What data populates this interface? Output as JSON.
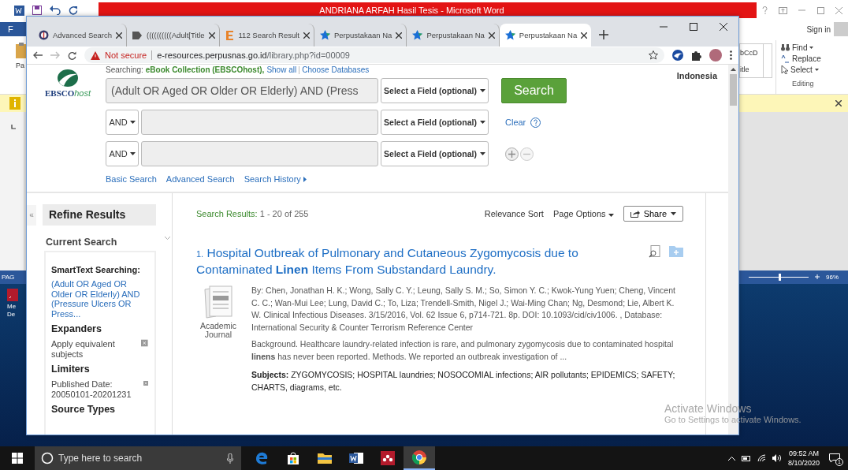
{
  "word": {
    "title": "ANDRIANA ARFAH  Hasil Tesis -  Microsoft Word",
    "file_tab": "F",
    "paste_label": "Pa",
    "sign_in": "Sign in",
    "style_preview": "bCcD",
    "style_name": "itle",
    "editing": [
      {
        "label": "Find",
        "has_menu": true
      },
      {
        "label": "Replace",
        "has_menu": false
      },
      {
        "label": "Select",
        "has_menu": true
      }
    ],
    "editing_group": "Editing",
    "status_text": "PAG",
    "zoom": {
      "level": 0.5,
      "reading": "96%"
    }
  },
  "desktop": {
    "icon_label": "Me De"
  },
  "chrome": {
    "tabs": [
      {
        "title": "Advanced Search",
        "kind": "ebsco",
        "selected": false
      },
      {
        "title": "((((((((((Adult[Title",
        "kind": "flag",
        "selected": false
      },
      {
        "title": "112 Search Result",
        "kind": "letter",
        "selected": false
      },
      {
        "title": "Perpustakaan Na",
        "kind": "star",
        "selected": false
      },
      {
        "title": "Perpustakaan Na",
        "kind": "star",
        "selected": false
      },
      {
        "title": "Perpustakaan Na",
        "kind": "star",
        "selected": true
      }
    ],
    "address": {
      "security": "Not secure",
      "host": "e-resources.perpusnas.go.id",
      "path": "/library.php?id=00009"
    }
  },
  "page": {
    "logo": {
      "text": "EBSCO",
      "suffix": "host"
    },
    "searching": {
      "label": "Searching:",
      "database": "eBook Collection (EBSCOhost),",
      "show_all": "Show all",
      "choose": "Choose Databases"
    },
    "library": "Indonesia",
    "search_rows": [
      {
        "value": "(Adult OR Aged OR Older OR Elderly) AND (Press",
        "field": "Select a Field (optional)"
      },
      {
        "operator": "AND",
        "field": "Select a Field (optional)"
      },
      {
        "operator": "AND",
        "field": "Select a Field (optional)"
      }
    ],
    "search_button": "Search",
    "clear": "Clear",
    "links": [
      {
        "label": "Basic Search",
        "has_arrow": false
      },
      {
        "label": "Advanced Search",
        "has_arrow": false
      },
      {
        "label": "Search History",
        "has_arrow": true
      }
    ],
    "sidebar": {
      "collapse": "«",
      "title": "Refine Results",
      "current_search": "Current Search",
      "items": [
        {
          "kind": "subheading",
          "text": "SmartText Searching:"
        },
        {
          "kind": "link",
          "text": "(Adult OR Aged OR Older OR Elderly) AND (Pressure Ulcers OR Press..."
        },
        {
          "kind": "heading",
          "text": "Expanders"
        },
        {
          "kind": "removable",
          "text": "Apply equivalent subjects"
        },
        {
          "kind": "heading",
          "text": "Limiters"
        },
        {
          "kind": "removable",
          "text": "Published Date: 20050101-20201231"
        },
        {
          "kind": "heading",
          "text": "Source Types"
        }
      ]
    },
    "results": {
      "label": "Search Results:",
      "range": "1 - 20 of 255",
      "sort": "Relevance Sort",
      "page_options": "Page Options",
      "share": "Share",
      "items": [
        {
          "number": "1.",
          "title": "Hospital Outbreak of Pulmonary and Cutaneous Zygomycosis due to Contaminated **Linen** Items From Substandard Laundry.",
          "type": "Academic Journal",
          "citation": "By: Chen, Jonathan H. K.; Wong, Sally C. Y.; Leung, Sally S. M.; So, Simon Y. C.; Kwok-Yung Yuen; Cheng, Vincent C. C.; Wan-Mui Lee; Lung, David C.; To, Liza; Trendell-Smith, Nigel J.; Wai-Ming Chan; Ng, Desmond; Lie, Albert K. W. Clinical Infectious Diseases. 3/15/2016, Vol. 62 Issue 6, p714-721. 8p. DOI: 10.1093/cid/civ1006. , Database: International Security & Counter Terrorism Reference Center",
          "abstract": "Background. Healthcare laundry-related infection is rare, and pulmonary zygomycosis due to contaminated hospital **linens** has never been reported. Methods. We reported an outbreak investigation of ...",
          "subjects": "**Subjects:** ZYGOMYCOSIS; HOSPITAL laundries; NOSOCOMIAL infections; AIR pollutants; EPIDEMICS; SAFETY; CHARTS, diagrams, etc."
        }
      ]
    }
  },
  "activation": {
    "title": "Activate Windows",
    "subtitle": "Go to Settings to activate Windows."
  },
  "taskbar": {
    "search_placeholder": "Type here to search",
    "apps": [
      {
        "kind": "edge",
        "selected": false
      },
      {
        "kind": "store",
        "selected": false
      },
      {
        "kind": "explorer",
        "selected": false
      },
      {
        "kind": "word",
        "selected": false
      },
      {
        "kind": "mendeley",
        "selected": false
      },
      {
        "kind": "chrome",
        "selected": true
      }
    ],
    "time": "09:52 AM",
    "date": "8/10/2020",
    "notifications": "1"
  }
}
